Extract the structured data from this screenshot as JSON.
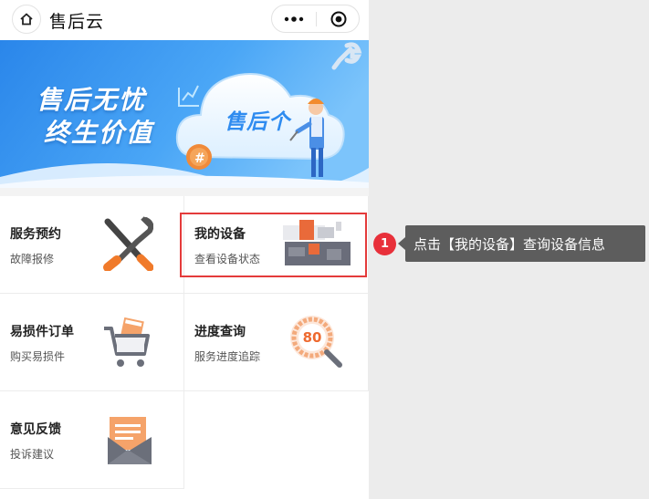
{
  "header": {
    "title": "售后云",
    "home_icon": "home-icon",
    "more_icon": "more-dots-icon",
    "close_icon": "target-close-icon"
  },
  "banner": {
    "line1": "售后无忧",
    "line2": "终生价值",
    "logo_text": "售后个"
  },
  "grid": [
    {
      "title": "服务预约",
      "subtitle": "故障报修",
      "icon": "wrench-screwdriver-icon"
    },
    {
      "title": "我的设备",
      "subtitle": "查看设备状态",
      "icon": "machine-icon"
    },
    {
      "title": "易损件订单",
      "subtitle": "购买易损件",
      "icon": "shopping-cart-icon"
    },
    {
      "title": "进度查询",
      "subtitle": "服务进度追踪",
      "icon": "progress-magnifier-icon",
      "icon_value": "80"
    },
    {
      "title": "意见反馈",
      "subtitle": "投诉建议",
      "icon": "envelope-icon"
    }
  ],
  "callout": {
    "step": "1",
    "text": "点击【我的设备】查询设备信息"
  },
  "colors": {
    "highlight": "#e43b3b",
    "badge": "#e8303a",
    "tooltip_bg": "#5d5d5d",
    "banner_blue": "#2f8cf0"
  }
}
